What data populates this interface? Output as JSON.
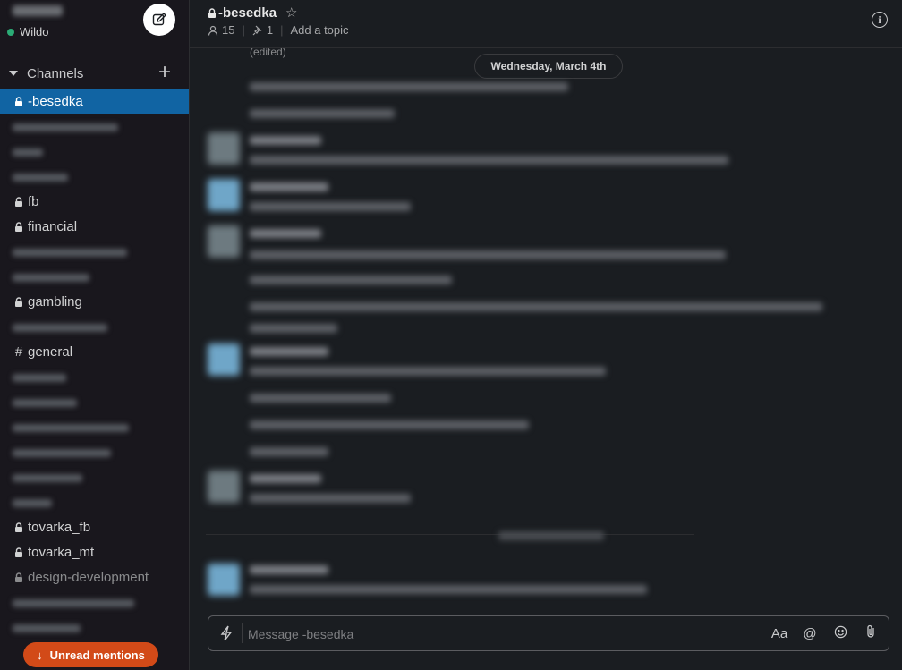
{
  "workspace": {
    "user_name": "Wildo",
    "status_color": "#2bac76"
  },
  "sidebar": {
    "section_label": "Channels",
    "add_label": "+",
    "channels": [
      {
        "name": "-besedka",
        "icon": "lock-icon",
        "active": true
      },
      {
        "name": "fb",
        "icon": "lock-icon"
      },
      {
        "name": "financial",
        "icon": "lock-icon"
      },
      {
        "name": "gambling",
        "icon": "lock-icon"
      },
      {
        "name": "general",
        "icon": "hash-icon",
        "glyph": "#"
      },
      {
        "name": "tovarka_fb",
        "icon": "lock-icon"
      },
      {
        "name": "tovarka_mt",
        "icon": "lock-icon"
      },
      {
        "name": "design-development",
        "icon": "lock-icon",
        "muted": true
      }
    ],
    "unread_label": "Unread mentions",
    "accent_color": "#1164a3",
    "unread_color": "#d24a18"
  },
  "header": {
    "channel_name": "-besedka",
    "member_count": "15",
    "pinned_count": "1",
    "topic_link": "Add a topic"
  },
  "messages": {
    "edited_label": "(edited)",
    "date_label": "Wednesday, March 4th"
  },
  "composer": {
    "placeholder": "Message -besedka",
    "format_label": "Aa",
    "mention_label": "@"
  }
}
